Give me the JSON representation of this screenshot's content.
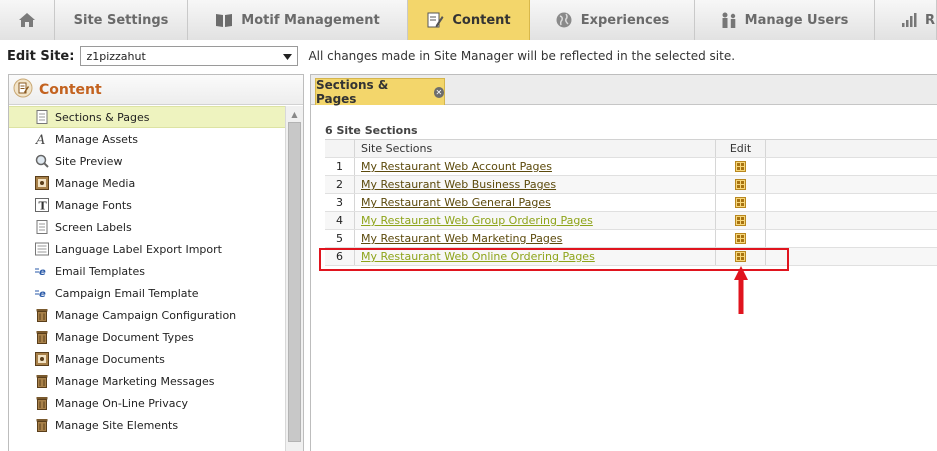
{
  "topnav": {
    "tabs": [
      {
        "label": "",
        "icon": "home-icon"
      },
      {
        "label": "Site Settings",
        "icon": ""
      },
      {
        "label": "Motif Management",
        "icon": "book-icon"
      },
      {
        "label": "Content",
        "icon": "pencil-note-icon",
        "active": true
      },
      {
        "label": "Experiences",
        "icon": "globe-icon"
      },
      {
        "label": "Manage Users",
        "icon": "users-icon"
      },
      {
        "label": "R",
        "icon": "bar-chart-icon"
      }
    ]
  },
  "sitebar": {
    "label": "Edit Site:",
    "selected_site": "z1pizzahut",
    "note": "All changes made in Site Manager will be reflected in the selected site."
  },
  "leftpanel": {
    "title": "Content",
    "items": [
      {
        "label": "Sections & Pages",
        "icon": "page-icon",
        "active": true
      },
      {
        "label": "Manage Assets",
        "icon": "font-a-icon"
      },
      {
        "label": "Site Preview",
        "icon": "magnifier-icon"
      },
      {
        "label": "Manage Media",
        "icon": "media-icon"
      },
      {
        "label": "Manage Fonts",
        "icon": "font-t-icon"
      },
      {
        "label": "Screen Labels",
        "icon": "page-icon"
      },
      {
        "label": "Language Label Export Import",
        "icon": "page-icon"
      },
      {
        "label": "Email Templates",
        "icon": "email-e-icon"
      },
      {
        "label": "Campaign Email Template",
        "icon": "email-e-icon"
      },
      {
        "label": "Manage Campaign Configuration",
        "icon": "trash-icon"
      },
      {
        "label": "Manage Document Types",
        "icon": "trash-icon"
      },
      {
        "label": "Manage Documents",
        "icon": "media-icon"
      },
      {
        "label": "Manage Marketing Messages",
        "icon": "trash-icon"
      },
      {
        "label": "Manage On-Line Privacy",
        "icon": "trash-icon"
      },
      {
        "label": "Manage Site Elements",
        "icon": "trash-icon"
      }
    ]
  },
  "rightpanel": {
    "tab_label": "Sections & Pages",
    "count_label": "6 Site Sections",
    "columns": {
      "sections": "Site Sections",
      "edit": "Edit"
    },
    "rows": [
      {
        "num": "1",
        "name": "My Restaurant Web Account Pages"
      },
      {
        "num": "2",
        "name": "My Restaurant Web Business Pages"
      },
      {
        "num": "3",
        "name": "My Restaurant Web General Pages"
      },
      {
        "num": "4",
        "name": "My Restaurant Web Group Ordering Pages"
      },
      {
        "num": "5",
        "name": "My Restaurant Web Marketing Pages"
      },
      {
        "num": "6",
        "name": "My Restaurant Web Online Ordering Pages"
      }
    ]
  },
  "colors": {
    "active_tab": "#f3d66b",
    "content_title": "#c3621f",
    "highlight": "#e0141e",
    "link": "#5c4a0c",
    "link_visited": "#8ea41a"
  }
}
